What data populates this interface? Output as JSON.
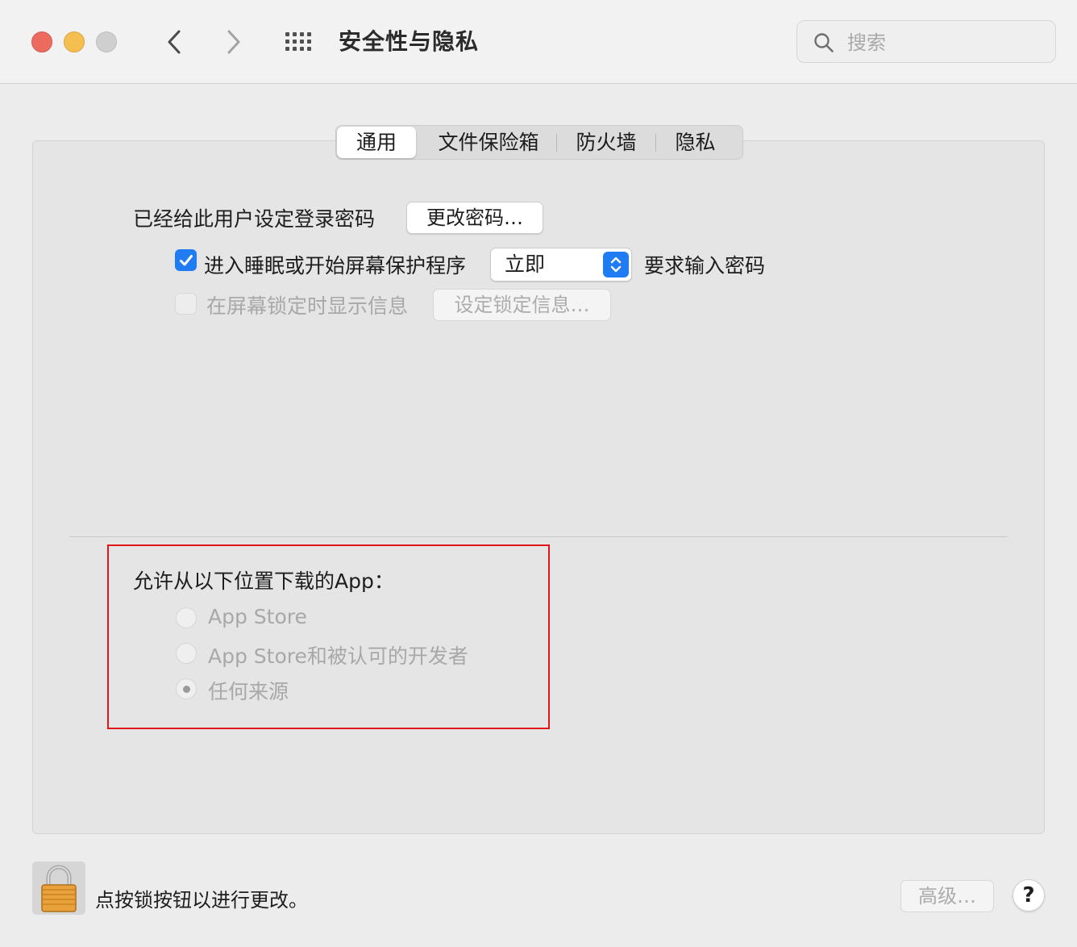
{
  "window": {
    "title": "安全性与隐私",
    "controls": [
      "close",
      "minimize",
      "zoom"
    ]
  },
  "toolbar": {
    "back_icon": "chevron-left-icon",
    "forward_icon": "chevron-right-icon",
    "grid_icon": "show-all-grid-icon",
    "search": {
      "placeholder": "搜索",
      "value": "",
      "icon": "search-icon"
    }
  },
  "tabs": [
    {
      "label": "通用",
      "selected": true
    },
    {
      "label": "文件保险箱",
      "selected": false
    },
    {
      "label": "防火墙",
      "selected": false
    },
    {
      "label": "隐私",
      "selected": false
    }
  ],
  "general": {
    "password_set_label": "已经给此用户设定登录密码",
    "change_password_button": "更改密码…",
    "require_password": {
      "checked": true,
      "label": "进入睡眠或开始屏幕保护程序",
      "delay_value": "立即",
      "suffix": "要求输入密码"
    },
    "lock_message": {
      "checked": false,
      "enabled": false,
      "label": "在屏幕锁定时显示信息",
      "button": "设定锁定信息…"
    }
  },
  "downloads": {
    "heading": "允许从以下位置下载的App：",
    "options": [
      {
        "label": "App Store",
        "selected": false
      },
      {
        "label": "App Store和被认可的开发者",
        "selected": false
      },
      {
        "label": "任何来源",
        "selected": true
      }
    ]
  },
  "footer": {
    "lock_icon": "padlock-icon",
    "lock_text": "点按锁按钮以进行更改。",
    "advanced_button": "高级…",
    "help_label": "?"
  },
  "colors": {
    "accent": "#1f7cf2",
    "close": "#ed6a5e",
    "minimize": "#f5bf4f",
    "zoom_inactive": "#cfcfcf",
    "highlight_box": "#e0161b"
  }
}
